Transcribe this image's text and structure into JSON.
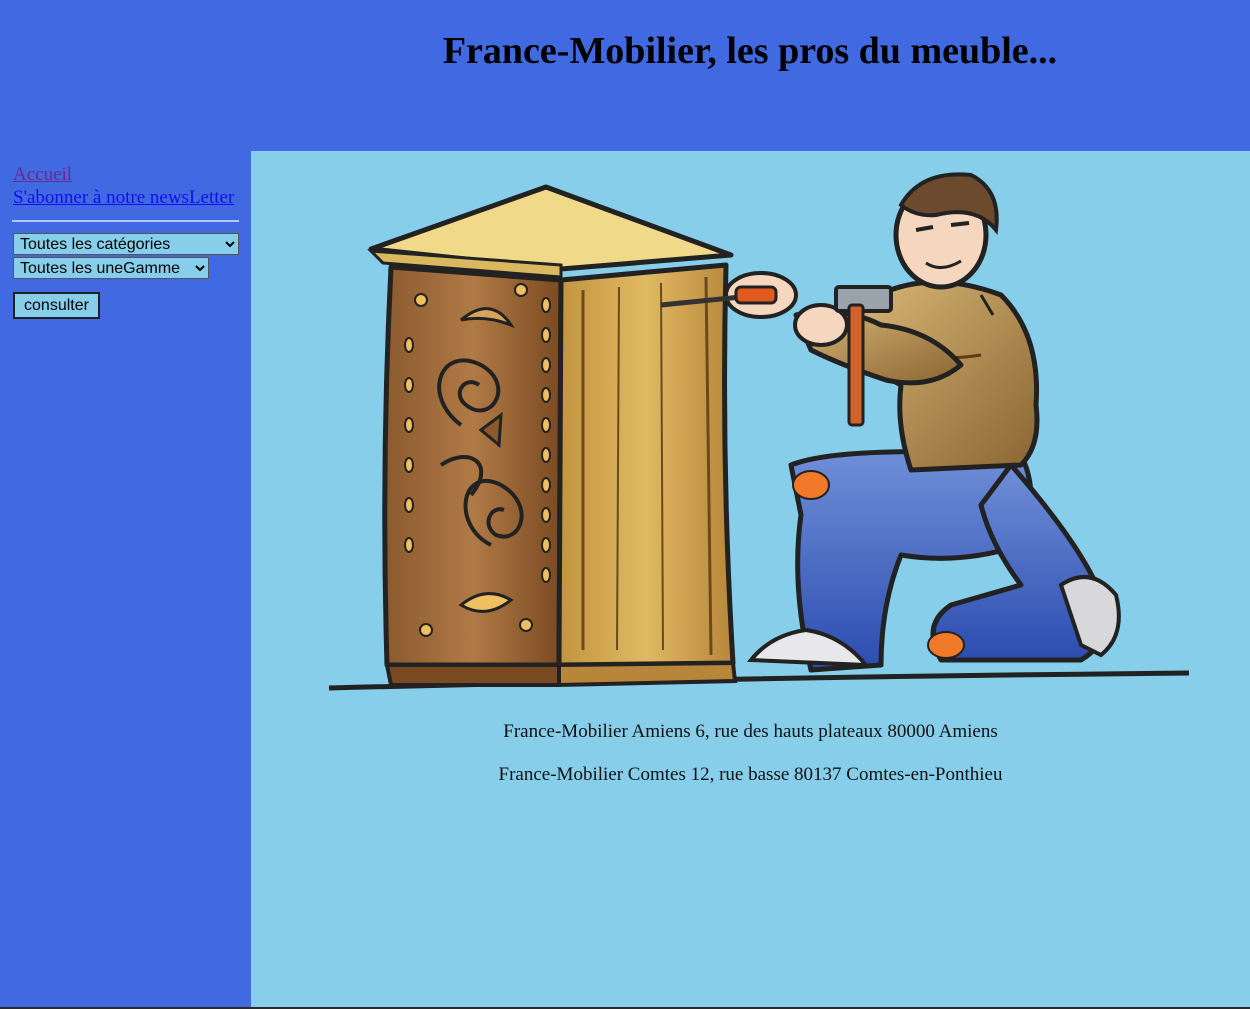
{
  "header": {
    "title": "France-Mobilier, les pros du meuble..."
  },
  "sidebar": {
    "links": [
      {
        "label": "Accueil"
      },
      {
        "label": "S'abonner à notre newsLetter"
      }
    ],
    "category_select": {
      "selected": "Toutes les catégories"
    },
    "range_select": {
      "selected": "Toutes les uneGamme"
    },
    "consult_label": "consulter"
  },
  "main": {
    "illustration": {
      "subject": "furniture-maker-illustration"
    },
    "addresses": [
      "France-Mobilier Amiens 6, rue des hauts plateaux 80000 Amiens",
      "France-Mobilier Comtes 12, rue basse 80137 Comtes-en-Ponthieu"
    ]
  },
  "colors": {
    "header_bg": "#4169e1",
    "sidebar_bg": "#4169e1",
    "main_bg": "#87ceeb",
    "visited_link": "#6a2a8c",
    "link": "#1010ee"
  }
}
